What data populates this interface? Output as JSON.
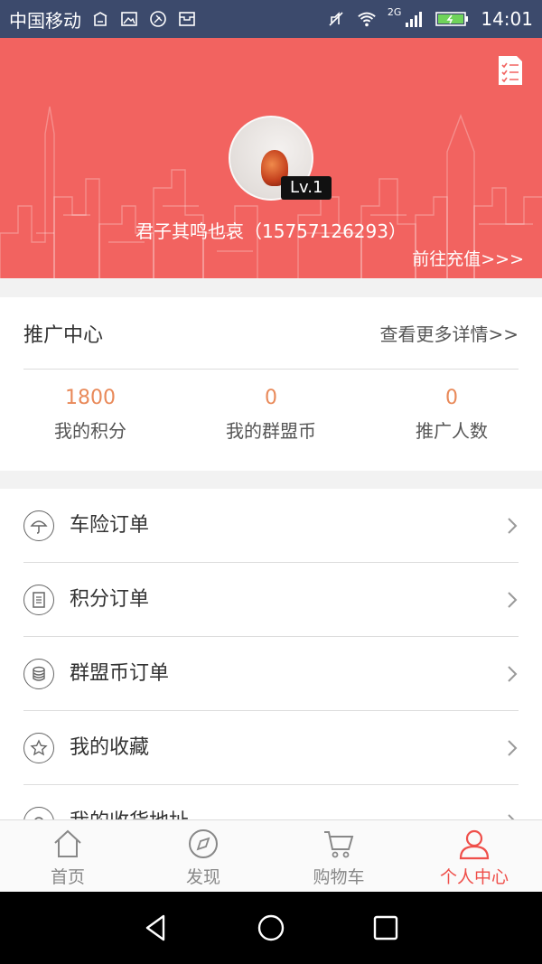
{
  "status_bar": {
    "carrier": "中国移动",
    "network": "2G",
    "time": "14:01"
  },
  "header": {
    "level": "Lv.1",
    "user_name": "君子其鸣也哀（15757126293）",
    "recharge_link": "前往充值>>>"
  },
  "promo": {
    "title": "推广中心",
    "more": "查看更多详情>>",
    "stats": [
      {
        "value": "1800",
        "label": "我的积分"
      },
      {
        "value": "0",
        "label": "我的群盟币"
      },
      {
        "value": "0",
        "label": "推广人数"
      }
    ]
  },
  "menu": {
    "items": [
      {
        "label": "车险订单",
        "icon": "umbrella-icon"
      },
      {
        "label": "积分订单",
        "icon": "receipt-icon"
      },
      {
        "label": "群盟币订单",
        "icon": "coins-icon"
      },
      {
        "label": "我的收藏",
        "icon": "star-icon"
      },
      {
        "label": "我的收货地址",
        "icon": "location-icon"
      }
    ]
  },
  "tabbar": {
    "tabs": [
      {
        "label": "首页",
        "icon": "home-icon",
        "active": false
      },
      {
        "label": "发现",
        "icon": "compass-icon",
        "active": false
      },
      {
        "label": "购物车",
        "icon": "cart-icon",
        "active": false
      },
      {
        "label": "个人中心",
        "icon": "person-icon",
        "active": true
      }
    ]
  },
  "colors": {
    "header_bg": "#f26360",
    "status_bg": "#3c4a6c",
    "accent": "#ef4f4a",
    "stat_value": "#e98a5a"
  }
}
